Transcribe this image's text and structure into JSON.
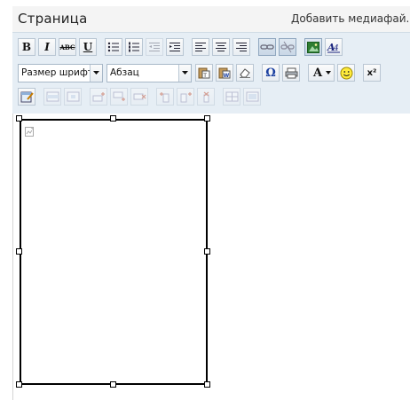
{
  "header": {
    "title": "Страница",
    "add_media_label": "Добавить медиафай."
  },
  "toolbar": {
    "row1": [
      {
        "name": "bold-button",
        "label": "B",
        "icon": "bold"
      },
      {
        "name": "italic-button",
        "label": "I",
        "icon": "italic"
      },
      {
        "name": "strikethrough-button",
        "label": "ABC",
        "icon": "strikethrough"
      },
      {
        "name": "underline-button",
        "label": "U",
        "icon": "underline"
      },
      {
        "name": "bullet-list-button",
        "icon": "bullet-list-icon"
      },
      {
        "name": "numbered-list-button",
        "icon": "numbered-list-icon"
      },
      {
        "name": "outdent-button",
        "icon": "outdent-icon"
      },
      {
        "name": "indent-button",
        "icon": "indent-icon"
      },
      {
        "name": "align-left-button",
        "icon": "align-left-icon"
      },
      {
        "name": "align-center-button",
        "icon": "align-center-icon"
      },
      {
        "name": "align-right-button",
        "icon": "align-right-icon"
      },
      {
        "name": "insert-link-button",
        "icon": "link-icon"
      },
      {
        "name": "remove-link-button",
        "icon": "unlink-icon"
      },
      {
        "name": "insert-image-button",
        "icon": "image-icon"
      },
      {
        "name": "text-style-button",
        "icon": "spellcheck-icon"
      }
    ],
    "font_size_select": {
      "value": "Размер шрифт"
    },
    "format_select": {
      "value": "Абзац"
    },
    "symbol_button_label": "Ω",
    "text_color_label": "A",
    "superscript_label": "x²"
  },
  "editor": {
    "image_placeholder": "broken-image-icon"
  }
}
